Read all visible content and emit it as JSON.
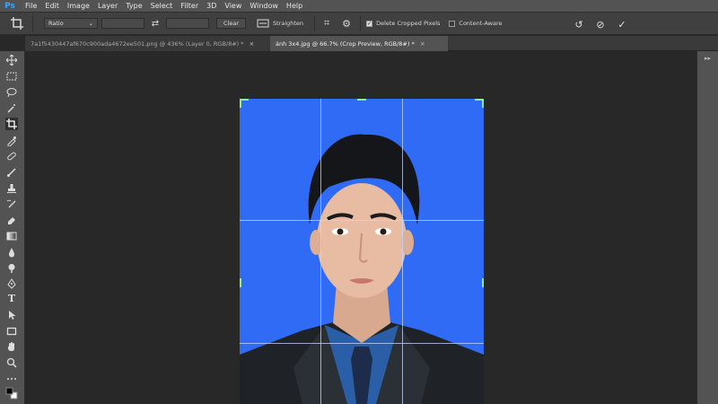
{
  "app": {
    "logo": "Ps"
  },
  "menu": [
    "File",
    "Edit",
    "Image",
    "Layer",
    "Type",
    "Select",
    "Filter",
    "3D",
    "View",
    "Window",
    "Help"
  ],
  "options": {
    "ratio_value": "Ratio",
    "clear_label": "Clear",
    "straighten_label": "Straighten",
    "delete_cropped_label": "Delete Cropped Pixels",
    "delete_cropped_checked": true,
    "content_aware_label": "Content-Aware",
    "content_aware_checked": false
  },
  "tabs": [
    {
      "label": "7a1f5430447af670c900ada4672ee501.png @ 436% (Layer 0, RGB/8#) *",
      "close": "×",
      "active": false
    },
    {
      "label": "ảnh 3x4.jpg @ 66.7% (Crop Preview, RGB/8#) *",
      "close": "×",
      "active": true
    }
  ],
  "colors": {
    "photo_background": "#2f6bf4",
    "crop_handle": "#8ff08a",
    "app_accent": "#31a8ff"
  },
  "icons": {
    "crop_tool": "crop-icon",
    "swap": "swap-icon",
    "straighten": "straighten-icon",
    "grid_overlay": "grid-icon",
    "settings": "gear-icon",
    "reset": "reset-icon",
    "cancel": "cancel-icon",
    "commit": "check-icon",
    "glyphs": {
      "dropdown": "⌄",
      "swap": "⇄",
      "grid": "⌗",
      "gear": "⚙",
      "reset": "↺",
      "cancel": "⊘",
      "commit": "✓",
      "check": "✓",
      "panel_collapse": "▸▸"
    }
  }
}
